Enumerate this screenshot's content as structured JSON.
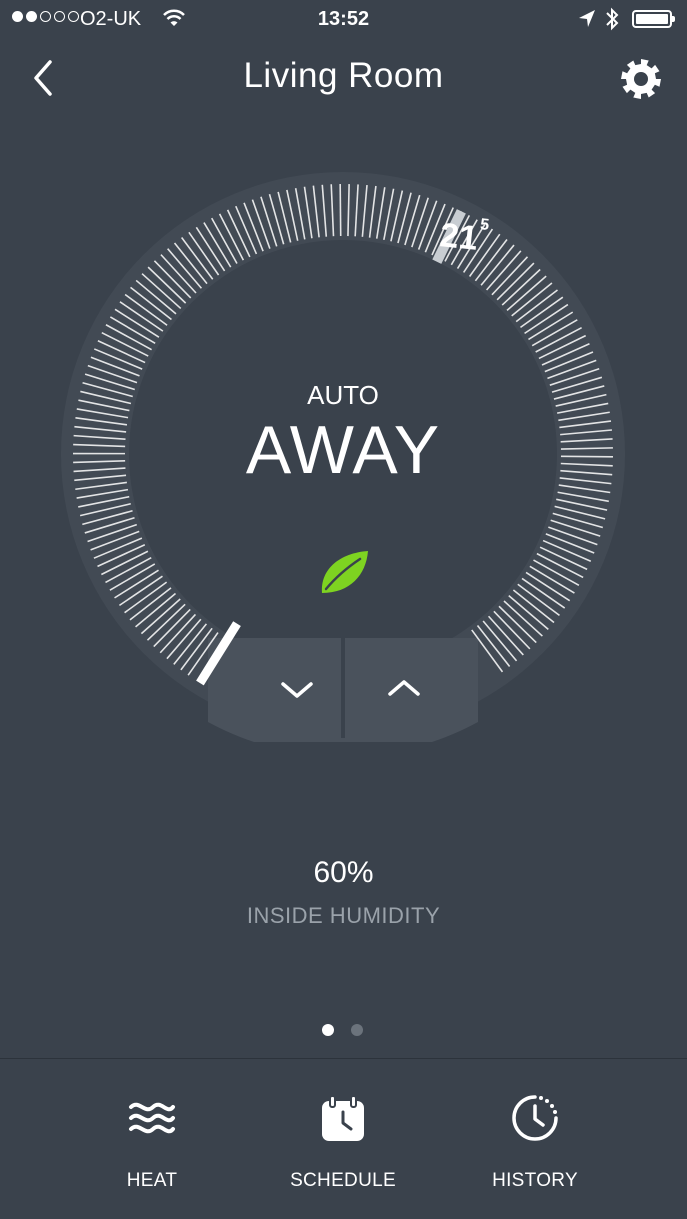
{
  "status_bar": {
    "carrier": "O2-UK",
    "time": "13:52",
    "signal_filled": 2,
    "signal_total": 5
  },
  "header": {
    "title": "Living Room",
    "back_icon": "chevron-left-icon",
    "settings_icon": "gear-icon"
  },
  "thermostat": {
    "mode_label": "AUTO",
    "mode_value": "AWAY",
    "target_temp_whole": "21",
    "target_temp_decimal": "5",
    "eco_icon": "leaf-icon",
    "eco_color": "#7ed321",
    "down_icon": "chevron-down-icon",
    "up_icon": "chevron-up-icon"
  },
  "humidity": {
    "value": "60%",
    "label": "INSIDE HUMIDITY"
  },
  "pager": {
    "pages": 2,
    "active": 0
  },
  "tabs": [
    {
      "label": "HEAT",
      "icon": "heat-waves-icon"
    },
    {
      "label": "SCHEDULE",
      "icon": "calendar-clock-icon"
    },
    {
      "label": "HISTORY",
      "icon": "history-clock-icon"
    }
  ],
  "colors": {
    "background": "#3a424c",
    "dial_ring": "#424a54",
    "button_bg": "#4a525c",
    "muted_text": "#9aa2aa"
  }
}
